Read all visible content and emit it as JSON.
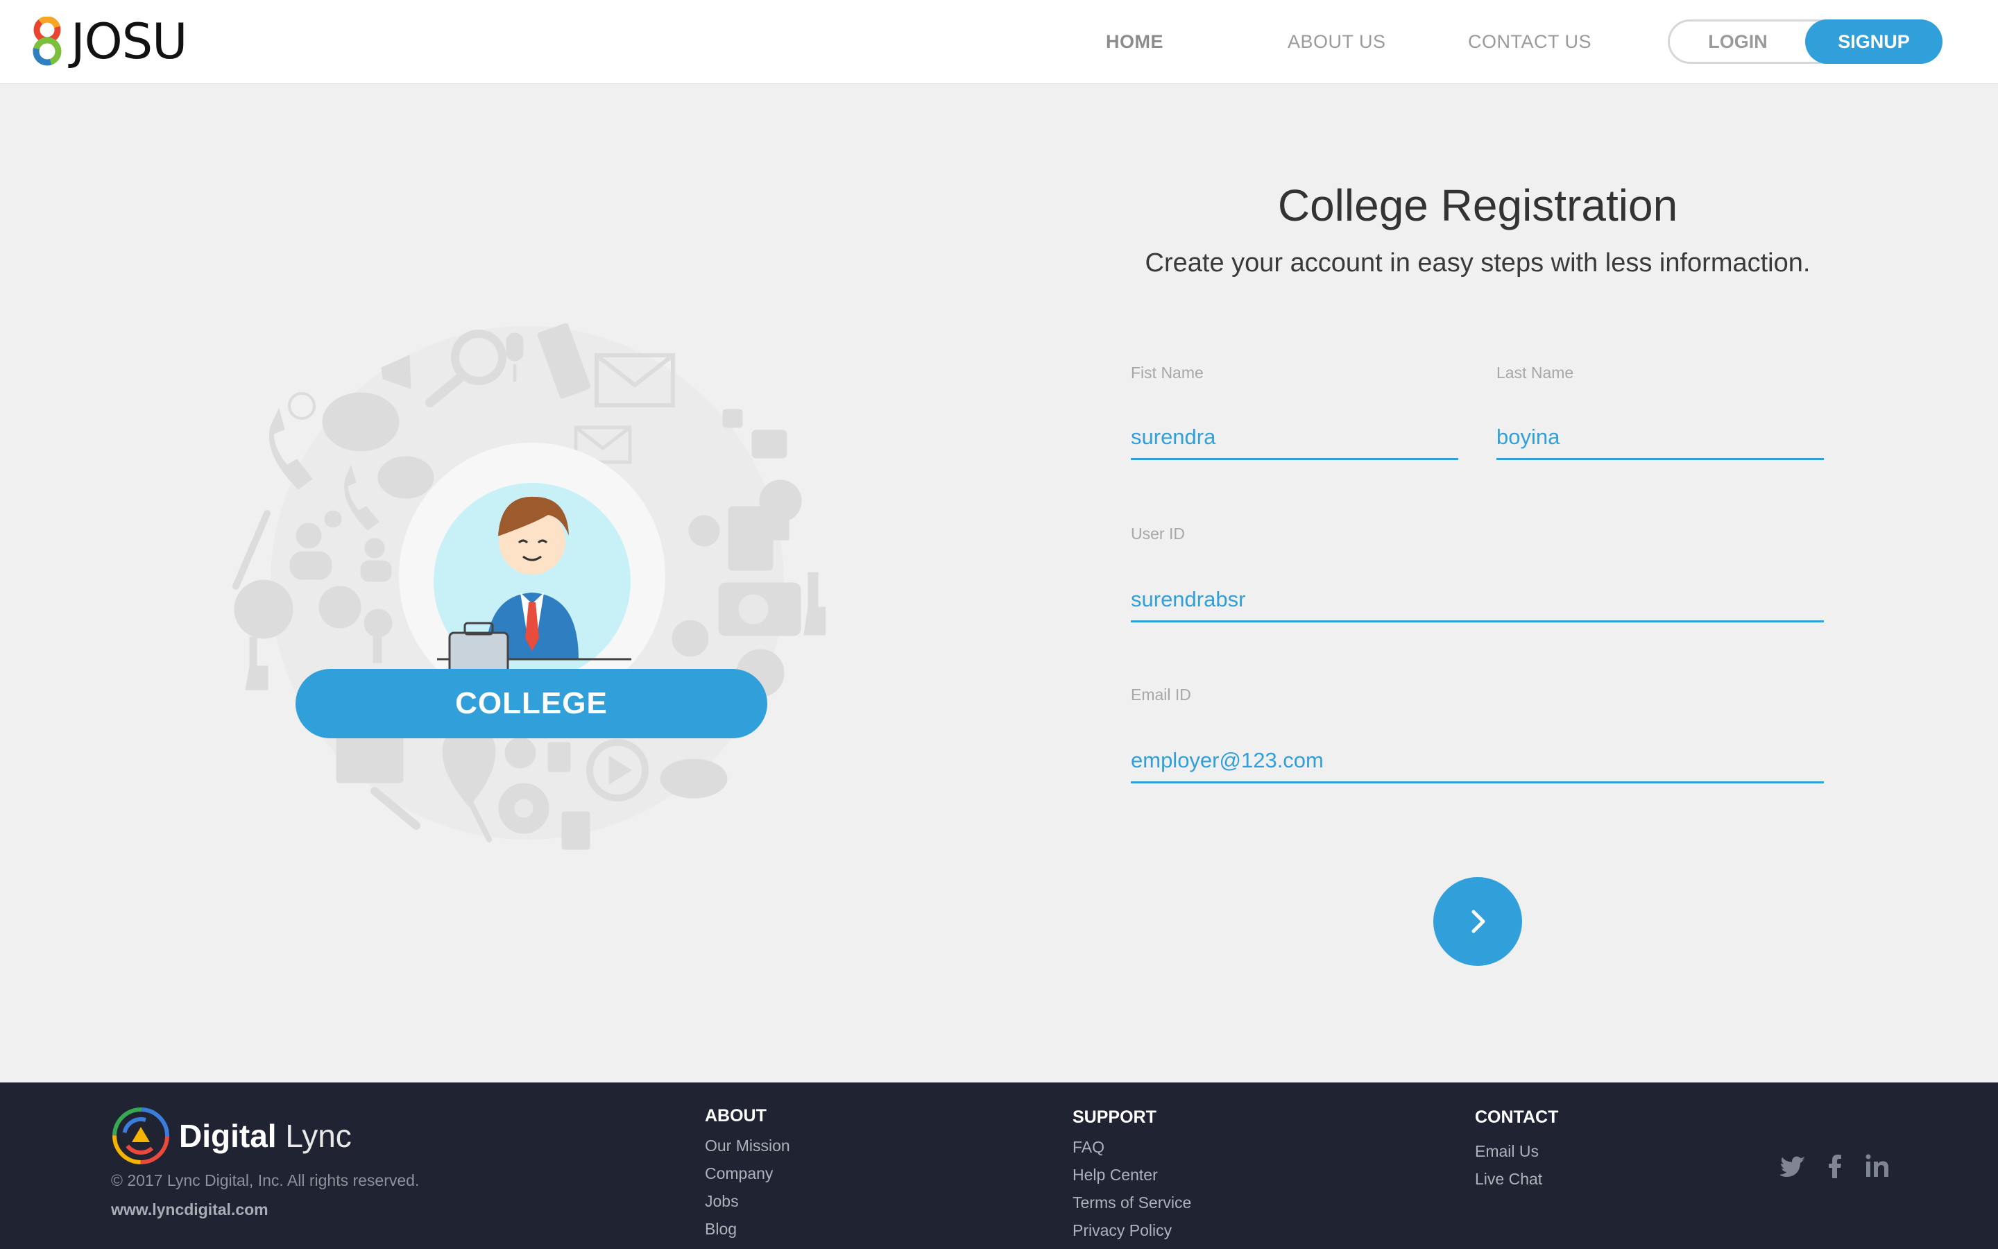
{
  "brand": {
    "name": "JOSU"
  },
  "nav": {
    "home": "HOME",
    "about": "ABOUT US",
    "contact": "CONTACT US",
    "login": "LOGIN",
    "signup": "SIGNUP"
  },
  "illustration": {
    "badge": "COLLEGE"
  },
  "form": {
    "title": "College Registration",
    "subtitle": "Create your account in easy steps with less informaction.",
    "first_name": {
      "label": "Fist Name",
      "value": "surendra"
    },
    "last_name": {
      "label": "Last Name",
      "value": "boyina"
    },
    "user_id": {
      "label": "User ID",
      "value": "surendrabsr"
    },
    "email": {
      "label": "Email ID",
      "value": "employer@123.com"
    },
    "next_icon": "chevron-right-icon"
  },
  "footer": {
    "brand_bold": "Digital",
    "brand_light": "Lync",
    "copyright": "© 2017 Lync Digital, Inc. All rights reserved.",
    "website": "www.lyncdigital.com",
    "about": {
      "heading": "ABOUT",
      "links": [
        "Our Mission",
        "Company",
        "Jobs",
        "Blog"
      ]
    },
    "support": {
      "heading": "SUPPORT",
      "links": [
        "FAQ",
        "Help Center",
        "Terms of Service",
        "Privacy Policy"
      ]
    },
    "contact": {
      "heading": "CONTACT",
      "links": [
        "Email Us",
        "Live Chat"
      ]
    },
    "social": [
      "twitter-icon",
      "facebook-icon",
      "linkedin-icon"
    ]
  },
  "colors": {
    "accent": "#31a0da",
    "footer_bg": "#1f2332",
    "page_bg": "#f0f0f0"
  }
}
